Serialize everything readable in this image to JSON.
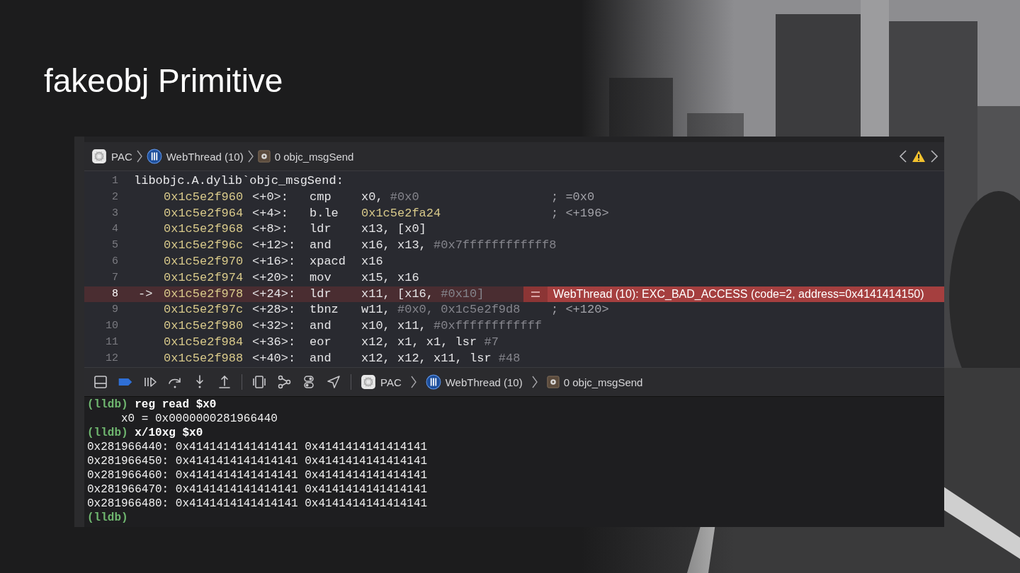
{
  "slide": {
    "title": "fakeobj Primitive"
  },
  "jump_bar": {
    "items": [
      {
        "kind": "app",
        "label": "PAC"
      },
      {
        "kind": "thread",
        "label": "WebThread (10)"
      },
      {
        "kind": "frame",
        "label": "0 objc_msgSend"
      }
    ]
  },
  "disassembly": {
    "lines": [
      {
        "number": "1",
        "kind": "label",
        "current": false,
        "text": "libobjc.A.dylib`objc_msgSend:"
      },
      {
        "number": "2",
        "kind": "instruction",
        "current": false,
        "address": "0x1c5e2f960",
        "offset": "<+0>:",
        "mnemonic": "cmp",
        "operands": [
          {
            "text": "x0,",
            "kind": "reg"
          },
          {
            "text": "#0x0",
            "kind": "imm"
          }
        ],
        "comment": "; =0x0"
      },
      {
        "number": "3",
        "kind": "instruction",
        "current": false,
        "address": "0x1c5e2f964",
        "offset": "<+4>:",
        "mnemonic": "b.le",
        "operands": [
          {
            "text": "0x1c5e2fa24",
            "kind": "addr"
          }
        ],
        "comment": "; <+196>"
      },
      {
        "number": "4",
        "kind": "instruction",
        "current": false,
        "address": "0x1c5e2f968",
        "offset": "<+8>:",
        "mnemonic": "ldr",
        "operands": [
          {
            "text": "x13, [x0]",
            "kind": "reg"
          }
        ]
      },
      {
        "number": "5",
        "kind": "instruction",
        "current": false,
        "address": "0x1c5e2f96c",
        "offset": "<+12>:",
        "mnemonic": "and",
        "operands": [
          {
            "text": "x16, x13,",
            "kind": "reg"
          },
          {
            "text": "#0x7ffffffffffff8",
            "kind": "imm"
          }
        ]
      },
      {
        "number": "6",
        "kind": "instruction",
        "current": false,
        "address": "0x1c5e2f970",
        "offset": "<+16>:",
        "mnemonic": "xpacd",
        "operands": [
          {
            "text": "x16",
            "kind": "reg"
          }
        ]
      },
      {
        "number": "7",
        "kind": "instruction",
        "current": false,
        "address": "0x1c5e2f974",
        "offset": "<+20>:",
        "mnemonic": "mov",
        "operands": [
          {
            "text": "x15, x16",
            "kind": "reg"
          }
        ]
      },
      {
        "number": "8",
        "kind": "instruction",
        "current": true,
        "arrow": "->",
        "address": "0x1c5e2f978",
        "offset": "<+24>:",
        "mnemonic": "ldr",
        "operands": [
          {
            "text": "x11, [x16,",
            "kind": "reg"
          },
          {
            "text": "#0x10]",
            "kind": "imm"
          }
        ],
        "error": "WebThread (10): EXC_BAD_ACCESS (code=2, address=0x4141414150)"
      },
      {
        "number": "9",
        "kind": "instruction",
        "current": false,
        "address": "0x1c5e2f97c",
        "offset": "<+28>:",
        "mnemonic": "tbnz",
        "operands": [
          {
            "text": "w11,",
            "kind": "reg"
          },
          {
            "text": "#0x0, 0x1c5e2f9d8",
            "kind": "imm"
          }
        ],
        "comment": "; <+120>"
      },
      {
        "number": "10",
        "kind": "instruction",
        "current": false,
        "address": "0x1c5e2f980",
        "offset": "<+32>:",
        "mnemonic": "and",
        "operands": [
          {
            "text": "x10, x11,",
            "kind": "reg"
          },
          {
            "text": "#0xffffffffffff",
            "kind": "imm"
          }
        ]
      },
      {
        "number": "11",
        "kind": "instruction",
        "current": false,
        "address": "0x1c5e2f984",
        "offset": "<+36>:",
        "mnemonic": "eor",
        "operands": [
          {
            "text": "x12, x1, x1, lsr",
            "kind": "reg"
          },
          {
            "text": "#7",
            "kind": "imm"
          }
        ]
      },
      {
        "number": "12",
        "kind": "instruction",
        "current": false,
        "address": "0x1c5e2f988",
        "offset": "<+40>:",
        "mnemonic": "and",
        "operands": [
          {
            "text": "x12, x12, x11, lsr",
            "kind": "reg"
          },
          {
            "text": "#48",
            "kind": "imm"
          }
        ]
      }
    ]
  },
  "debug_bar": {
    "buttons": [
      {
        "kind": "console-toggle",
        "active": false
      },
      {
        "kind": "breakpoints",
        "active": true
      },
      {
        "kind": "continue",
        "active": false
      },
      {
        "kind": "step-over",
        "active": false
      },
      {
        "kind": "step-into",
        "active": false
      },
      {
        "kind": "step-out",
        "active": false
      },
      {
        "kind": "separator"
      },
      {
        "kind": "view-debugger",
        "active": false
      },
      {
        "kind": "memory-graph",
        "active": false
      },
      {
        "kind": "environment",
        "active": false
      },
      {
        "kind": "location",
        "active": false
      },
      {
        "kind": "separator"
      }
    ],
    "jump_bar": {
      "items": [
        {
          "kind": "app",
          "label": "PAC"
        },
        {
          "kind": "thread",
          "label": "WebThread (10)"
        },
        {
          "kind": "frame",
          "label": "0 objc_msgSend"
        }
      ]
    }
  },
  "console": {
    "lines": [
      {
        "kind": "command",
        "prompt": "(lldb)",
        "text": "reg read $x0"
      },
      {
        "kind": "output",
        "text": "     x0 = 0x0000000281966440"
      },
      {
        "kind": "command",
        "prompt": "(lldb)",
        "text": "x/10xg $x0"
      },
      {
        "kind": "output",
        "text": "0x281966440: 0x4141414141414141 0x4141414141414141"
      },
      {
        "kind": "output",
        "text": "0x281966450: 0x4141414141414141 0x4141414141414141"
      },
      {
        "kind": "output",
        "text": "0x281966460: 0x4141414141414141 0x4141414141414141"
      },
      {
        "kind": "output",
        "text": "0x281966470: 0x4141414141414141 0x4141414141414141"
      },
      {
        "kind": "output",
        "text": "0x281966480: 0x4141414141414141 0x4141414141414141"
      },
      {
        "kind": "command",
        "prompt": "(lldb)"
      }
    ]
  }
}
